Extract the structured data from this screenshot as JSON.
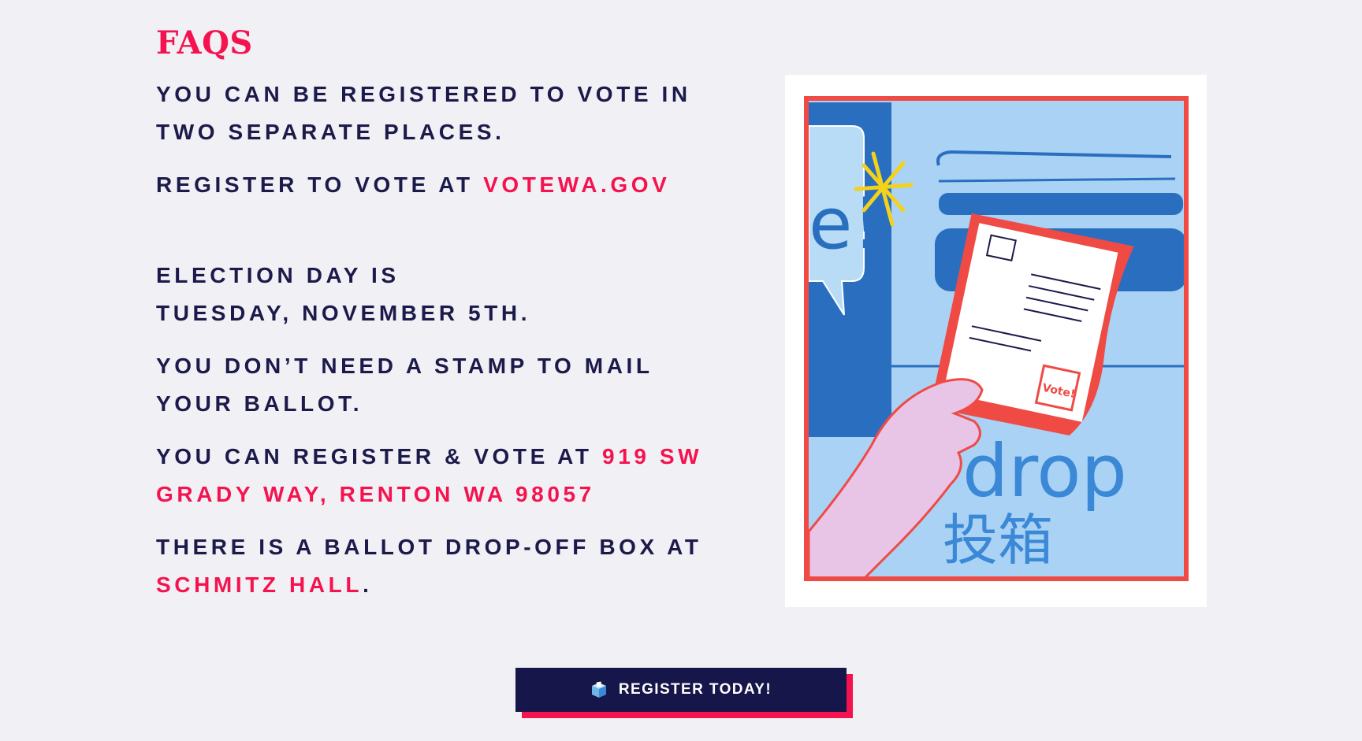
{
  "faq": {
    "title": "FAQS",
    "items": [
      {
        "text": "YOU CAN BE REGISTERED TO VOTE IN TWO SEPARATE PLACES."
      },
      {
        "text": "REGISTER TO VOTE AT ",
        "link": "VOTEWA.GOV"
      },
      {
        "text": "ELECTION DAY IS\nTUESDAY, NOVEMBER 5TH."
      },
      {
        "text": "YOU DON’T NEED A STAMP TO MAIL YOUR BALLOT."
      },
      {
        "text": "YOU CAN REGISTER & VOTE AT ",
        "link": "919 SW GRADY WAY, RENTON WA 98057"
      },
      {
        "text": "THERE IS A BALLOT DROP-OFF BOX AT ",
        "link": "SCHMITZ HALL",
        "after": "."
      }
    ]
  },
  "illustration": {
    "painted_words": [
      "e!",
      "drop",
      "投箱",
      "Vote!"
    ]
  },
  "cta": {
    "label": "REGISTER TODAY!",
    "icon": "ballot-box-icon"
  },
  "colors": {
    "background": "#f1f0f5",
    "navy": "#1b1a4a",
    "accent": "#f5134f",
    "button": "#17164a"
  }
}
